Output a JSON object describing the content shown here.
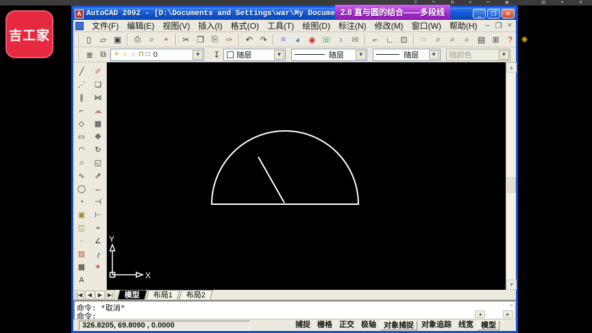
{
  "recorder_bar": {
    "icons": [
      "⚲",
      "✎",
      "⊞",
      "⌗",
      "✂",
      "▣",
      "◌",
      "▤",
      "✦",
      "≣"
    ]
  },
  "logo": {
    "text": "吉工家"
  },
  "window": {
    "icon_letter": "A",
    "title": "AutoCAD 2002 - [D:\\Documents and Settings\\war\\My Document",
    "overlay_title": "2.8 直与圆的结合——多段线",
    "controls": {
      "minimize": "_",
      "maximize": "❐",
      "close": "✕"
    },
    "doc_controls": [
      "–",
      "❐",
      "×"
    ]
  },
  "menu": {
    "items": [
      "文件(F)",
      "编辑(E)",
      "视图(V)",
      "插入(I)",
      "格式(O)",
      "工具(T)",
      "绘图(D)",
      "标注(N)",
      "修改(M)",
      "窗口(W)",
      "帮助(H)"
    ]
  },
  "toolbar_standard": [
    {
      "name": "new-file",
      "glyph": "▯"
    },
    {
      "name": "open-file",
      "glyph": "▱"
    },
    {
      "name": "save",
      "glyph": "▣"
    },
    {
      "sep": true
    },
    {
      "name": "print",
      "glyph": "⎙"
    },
    {
      "name": "print-preview",
      "glyph": "⌕"
    },
    {
      "name": "find",
      "glyph": "⌖",
      "color": "#a84a3a"
    },
    {
      "sep": true
    },
    {
      "name": "cut",
      "glyph": "✂"
    },
    {
      "name": "copy",
      "glyph": "❐"
    },
    {
      "name": "paste",
      "glyph": "⎘"
    },
    {
      "name": "match-properties",
      "glyph": "✑",
      "color": "#8a6d3b"
    },
    {
      "sep": true
    },
    {
      "name": "undo",
      "glyph": "↶"
    },
    {
      "name": "redo",
      "glyph": "↷"
    },
    {
      "sep": true
    },
    {
      "name": "insert-hyperlink",
      "glyph": "⌗",
      "color": "#2255cc"
    },
    {
      "name": "autocad-today",
      "glyph": "◕",
      "color": "#2a7de0"
    },
    {
      "name": "autodesk-point-a",
      "glyph": "◉",
      "color": "#cc3333"
    },
    {
      "name": "meet-now",
      "glyph": "☏",
      "color": "#2a9d4e"
    },
    {
      "name": "publish-web",
      "glyph": "♁",
      "color": "#2a7de0"
    },
    {
      "name": "etransmit",
      "glyph": "✉",
      "color": "#777777"
    },
    {
      "sep": true
    },
    {
      "name": "temporary-track-point",
      "glyph": "⌐"
    },
    {
      "name": "snap-from",
      "glyph": "∟"
    },
    {
      "name": "ucs-tool",
      "glyph": "⊡"
    },
    {
      "sep": true
    },
    {
      "name": "pan-realtime",
      "glyph": "☞",
      "color": "#2a9d4e"
    },
    {
      "name": "zoom-realtime",
      "glyph": "⌕"
    },
    {
      "name": "zoom-window",
      "glyph": "⌕"
    },
    {
      "name": "zoom-previous",
      "glyph": "⌕"
    },
    {
      "name": "properties-palette",
      "glyph": "▤"
    },
    {
      "name": "designcenter",
      "glyph": "⊞"
    },
    {
      "name": "help",
      "glyph": "?",
      "color": "#cc2222"
    },
    {
      "name": "active-assistance",
      "glyph": "✺",
      "color": "#d4a017"
    }
  ],
  "toolbar_properties": {
    "layer_manager_glyph": "≣",
    "layers_glyph": "⧉",
    "layer_icons": [
      {
        "name": "bulb-icon",
        "glyph": "☀",
        "color": "#c8a800"
      },
      {
        "name": "sun-icon",
        "glyph": "☼",
        "color": "#c8a800"
      },
      {
        "name": "freeze-icon",
        "glyph": "☼",
        "color": "#9a9a9a"
      },
      {
        "name": "lock-icon",
        "glyph": "⊓",
        "color": "#777700"
      },
      {
        "name": "layer-swatch",
        "glyph": "□",
        "color": "#333333"
      }
    ],
    "layer_value": "0",
    "make_current_glyph": "↧",
    "color_value": "随层",
    "linetype_value": "随层",
    "lineweight_value": "随层",
    "plotstyle_value": "随颜色"
  },
  "draw_tools": [
    {
      "name": "line",
      "glyph": "╱"
    },
    {
      "name": "construction-line",
      "glyph": "⋰"
    },
    {
      "name": "multiline",
      "glyph": "∥"
    },
    {
      "name": "polyline",
      "glyph": "⌐"
    },
    {
      "name": "polygon",
      "glyph": "◇"
    },
    {
      "name": "rectangle",
      "glyph": "▭"
    },
    {
      "name": "arc",
      "glyph": "◠"
    },
    {
      "name": "circle",
      "glyph": "○"
    },
    {
      "name": "spline",
      "glyph": "∿"
    },
    {
      "name": "ellipse",
      "glyph": "◯"
    },
    {
      "name": "ellipse-arc",
      "glyph": "◔"
    },
    {
      "name": "insert-block",
      "glyph": "▣",
      "color": "#9a8a2a"
    },
    {
      "name": "make-block",
      "glyph": "◫",
      "color": "#9a8a2a"
    },
    {
      "name": "point",
      "glyph": "·"
    },
    {
      "name": "hatch",
      "glyph": "▨",
      "color": "#a85a4a"
    },
    {
      "name": "region",
      "glyph": "▩"
    },
    {
      "name": "text",
      "glyph": "A"
    }
  ],
  "modify_tools": [
    {
      "name": "erase",
      "glyph": "✐",
      "color": "#b06060"
    },
    {
      "name": "copy-object",
      "glyph": "❏"
    },
    {
      "name": "mirror",
      "glyph": "⋈"
    },
    {
      "name": "offset",
      "glyph": "☁",
      "color": "#c08080"
    },
    {
      "name": "array",
      "glyph": "▦"
    },
    {
      "name": "move",
      "glyph": "✥"
    },
    {
      "name": "rotate",
      "glyph": "↻"
    },
    {
      "name": "scale",
      "glyph": "◱"
    },
    {
      "name": "stretch",
      "glyph": "⇗"
    },
    {
      "name": "lengthen",
      "glyph": "↔"
    },
    {
      "name": "trim",
      "glyph": "⊣"
    },
    {
      "name": "extend",
      "glyph": "⊢"
    },
    {
      "name": "break",
      "glyph": "⌁"
    },
    {
      "name": "chamfer",
      "glyph": "∠"
    },
    {
      "name": "fillet",
      "glyph": "╭"
    },
    {
      "name": "explode",
      "glyph": "✴",
      "color": "#c03020"
    }
  ],
  "canvas": {
    "ucs_y_label": "Y",
    "ucs_x_label": "X"
  },
  "tabs": {
    "nav": [
      "|◀",
      "◀",
      "▶",
      "▶|"
    ],
    "items": [
      {
        "label": "模型",
        "active": true
      },
      {
        "label": "布局1",
        "active": false
      },
      {
        "label": "布局2",
        "active": false
      }
    ]
  },
  "command": {
    "lines": [
      "命令: *取消*",
      "命令:"
    ],
    "scroll_left": "◀",
    "scroll_right": "▶"
  },
  "status": {
    "coords": "326.8205, 69.8090 , 0.0000",
    "toggles": [
      {
        "label": "捕捉",
        "raised": false
      },
      {
        "label": "栅格",
        "raised": false
      },
      {
        "label": "正交",
        "raised": false
      },
      {
        "label": "极轴",
        "raised": false
      },
      {
        "label": "对象捕捉",
        "raised": true
      },
      {
        "label": "对象追踪",
        "raised": false
      },
      {
        "label": "线宽",
        "raised": false
      },
      {
        "label": "模型",
        "raised": true
      }
    ]
  },
  "colors": {
    "title_accent": "#0f52d8",
    "overlay_purple": "#a92fd0",
    "logo_red": "#e7293f"
  }
}
